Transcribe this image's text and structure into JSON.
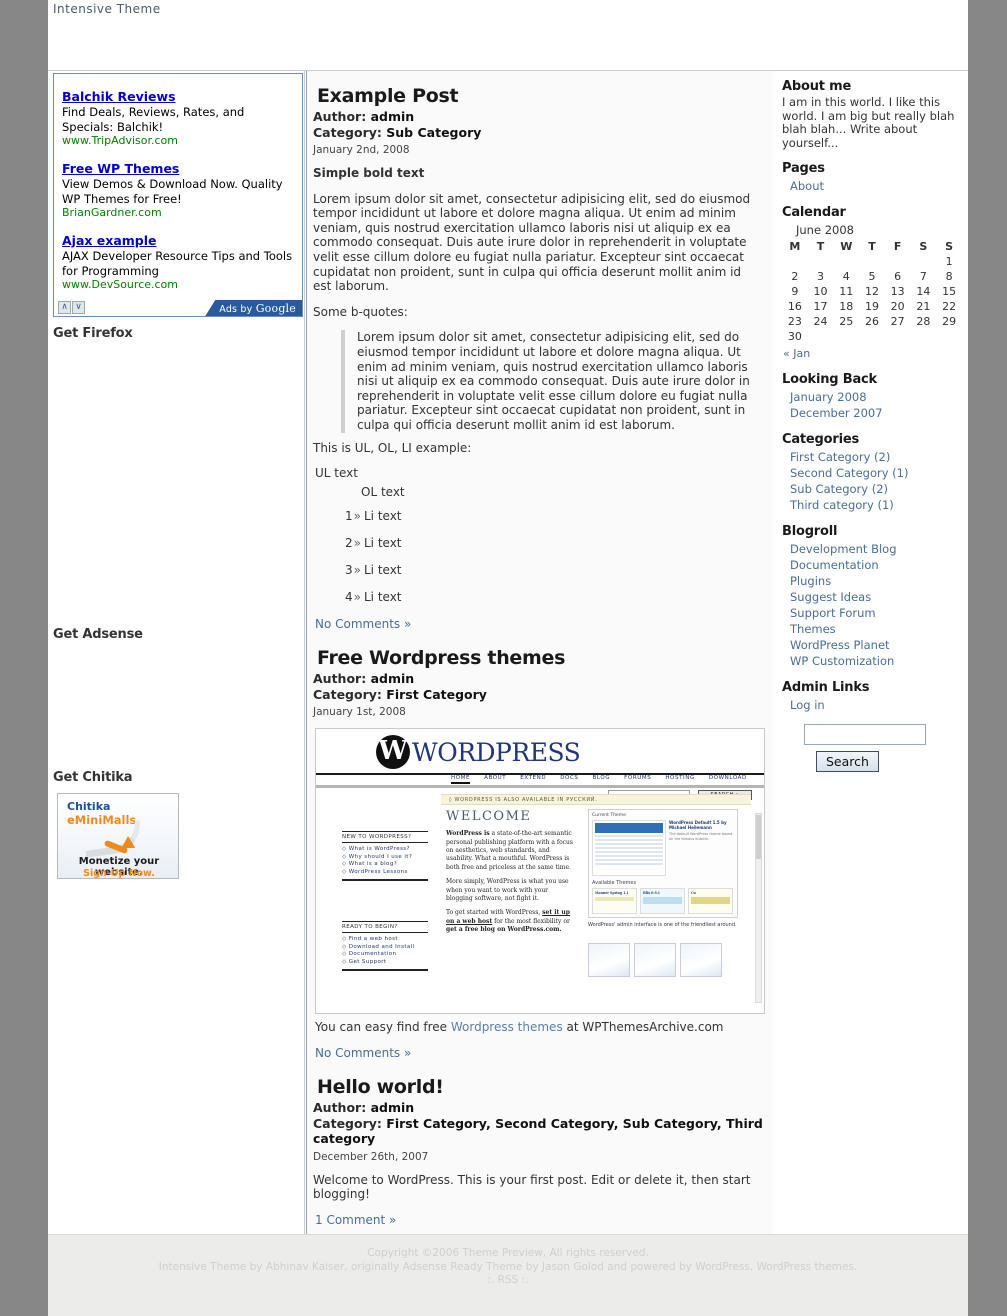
{
  "header": {
    "blog_title": "Intensive Theme"
  },
  "ads": {
    "units": [
      {
        "title": "Balchik Reviews",
        "desc": "Find Deals, Reviews, Rates, and Specials: Balchik!",
        "url": "www.TripAdvisor.com"
      },
      {
        "title": "Free WP Themes",
        "desc": "View Demos & Download Now. Quality WP Themes for Free!",
        "url": "BrianGardner.com"
      },
      {
        "title": "Ajax example",
        "desc": "AJAX Developer Resource Tips and Tools for Programming",
        "url": "www.DevSource.com"
      }
    ],
    "arrow_up": "∧",
    "arrow_down": "∨",
    "ads_by_prefix": "Ads by ",
    "ads_by_brand": "Google"
  },
  "left_sidebar": {
    "widgets": [
      {
        "title": "Get Firefox"
      },
      {
        "title": "Get Adsense"
      },
      {
        "title": "Get Chitika"
      }
    ],
    "chitika": {
      "brand": "Chitika",
      "product": "eMiniMalls",
      "tagline": "Monetize your website.",
      "cta": "Sign-Up Now."
    }
  },
  "posts": [
    {
      "title": "Example Post",
      "author_label": "Author:",
      "author": "admin",
      "category_label": "Category:",
      "category": "Sub Category",
      "date": "January 2nd, 2008",
      "bold_lead": "Simple bold text",
      "body1": "Lorem ipsum dolor sit amet, consectetur adipisicing elit, sed do eiusmod tempor incididunt ut labore et dolore magna aliqua. Ut enim ad minim veniam, quis nostrud exercitation ullamco laboris nisi ut aliquip ex ea commodo consequat. Duis aute irure dolor in reprehenderit in voluptate velit esse cillum dolore eu fugiat nulla pariatur. Excepteur sint occaecat cupidatat non proident, sunt in culpa qui officia deserunt mollit anim id est laborum.",
      "bquote_label": "Some b-quotes:",
      "blockquote": "Lorem ipsum dolor sit amet, consectetur adipisicing elit, sed do eiusmod tempor incididunt ut labore et dolore magna aliqua. Ut enim ad minim veniam, quis nostrud exercitation ullamco laboris nisi ut aliquip ex ea commodo consequat. Duis aute irure dolor in reprehenderit in voluptate velit esse cillum dolore eu fugiat nulla pariatur. Excepteur sint occaecat cupidatat non proident, sunt in culpa qui officia deserunt mollit anim id est laborum.",
      "list_label": "This is UL, OL, LI example:",
      "ul_text": "UL text",
      "ol_text": "OL text",
      "li_items": [
        {
          "num": "1",
          "arrow": "»",
          "text": "Li text"
        },
        {
          "num": "2",
          "arrow": "»",
          "text": "Li text"
        },
        {
          "num": "3",
          "arrow": "»",
          "text": "Li text"
        },
        {
          "num": "4",
          "arrow": "»",
          "text": "Li text"
        }
      ],
      "comments": "No Comments »"
    },
    {
      "title": "Free Wordpress themes",
      "author_label": "Author:",
      "author": "admin",
      "category_label": "Category:",
      "category": "First Category",
      "date": "January 1st, 2008",
      "caption_before": "You can easy find free ",
      "caption_link": "Wordpress themes",
      "caption_after": " at WPThemesArchive.com",
      "comments": "No Comments »"
    },
    {
      "title": "Hello world!",
      "author_label": "Author:",
      "author": "admin",
      "category_label": "Category:",
      "category": "First Category, Second Category, Sub Category, Third category",
      "date": "December 26th, 2007",
      "body1": "Welcome to WordPress. This is your first post. Edit or delete it, then start blogging!",
      "comments": "1 Comment »"
    }
  ],
  "wp_screenshot": {
    "mark": "W",
    "wordmark": "WORDPRESS",
    "nav": [
      "HOME",
      "ABOUT",
      "EXTEND",
      "DOCS",
      "BLOG",
      "FORUMS",
      "HOSTING",
      "DOWNLOAD"
    ],
    "search_button": "SEARCH »",
    "ru_notice": "◊ WORDPRESS IS ALSO AVAILABLE IN РУССКИЙ.",
    "welcome": "WELCOME",
    "intro1_bold": "WordPress is",
    "intro1": " a state-of-the-art semantic personal publishing platform with a focus on aesthetics, web standards, and usability. What a mouthful. WordPress is both free and priceless at the same time.",
    "intro2": "More simply, WordPress is what you use when you want to work with your blogging software, not fight it.",
    "intro3_a": "To get started with WordPress, ",
    "intro3_b": "set it up on a web host",
    "intro3_c": " for the most flexibility or ",
    "intro3_d": "get a free blog on WordPress.com.",
    "new_heading": "NEW TO WORDPRESS?",
    "new_links": [
      "What is WordPress?",
      "Why should I use it?",
      "What is a blog?",
      "WordPress Lessons"
    ],
    "ready_heading": "READY TO BEGIN?",
    "ready_links": [
      "Find a web host",
      "Download and Install",
      "Documentation",
      "Get Support"
    ],
    "current_theme": "Current Theme",
    "theme_name": "WordPress Default 1.5 by Michael Heilemann",
    "theme_desc": "The default WordPress theme based on the famous Kubrick.",
    "available_themes": "Available Themes",
    "themes": [
      "Manner Spring 1.1",
      "Blix 0.9.1",
      "Cu"
    ],
    "admin_caption": "WordPress' admin interface is one of the friendliest around."
  },
  "right_sidebar": {
    "about": {
      "title": "About me",
      "text": "I am in this world. I like this world. I am big but really blah blah blah... Write about yourself..."
    },
    "pages": {
      "title": "Pages",
      "items": [
        "About"
      ]
    },
    "calendar": {
      "title": "Calendar",
      "caption": "June 2008",
      "day_headers": [
        "M",
        "T",
        "W",
        "T",
        "F",
        "S",
        "S"
      ],
      "weeks": [
        [
          "",
          "",
          "",
          "",
          "",
          "",
          "1"
        ],
        [
          "2",
          "3",
          "4",
          "5",
          "6",
          "7",
          "8"
        ],
        [
          "9",
          "10",
          "11",
          "12",
          "13",
          "14",
          "15"
        ],
        [
          "16",
          "17",
          "18",
          "19",
          "20",
          "21",
          "22"
        ],
        [
          "23",
          "24",
          "25",
          "26",
          "27",
          "28",
          "29"
        ],
        [
          "30",
          "",
          "",
          "",
          "",
          "",
          ""
        ]
      ],
      "prev_link": "« Jan"
    },
    "looking_back": {
      "title": "Looking Back",
      "items": [
        "January 2008",
        "December 2007"
      ]
    },
    "categories": {
      "title": "Categories",
      "items": [
        "First Category (2)",
        "Second Category (1)",
        "Sub Category (2)",
        "Third category (1)"
      ]
    },
    "blogroll": {
      "title": "Blogroll",
      "items": [
        "Development Blog",
        "Documentation",
        "Plugins",
        "Suggest Ideas",
        "Support Forum",
        "Themes",
        "WordPress Planet",
        "WP Customization"
      ]
    },
    "admin_links": {
      "title": "Admin Links",
      "items": [
        "Log in"
      ]
    },
    "search": {
      "value": "",
      "placeholder": "",
      "button": "Search"
    }
  },
  "footer": {
    "line1": "Copyright ©2006 Theme Preview, All rights reserved.",
    "line2": "Intensive Theme by Abhinav Kaiser, originally Adsense Ready Theme by Jason Golod and powered by WordPress, WordPress themes.",
    "line3": ":. RSS :."
  }
}
